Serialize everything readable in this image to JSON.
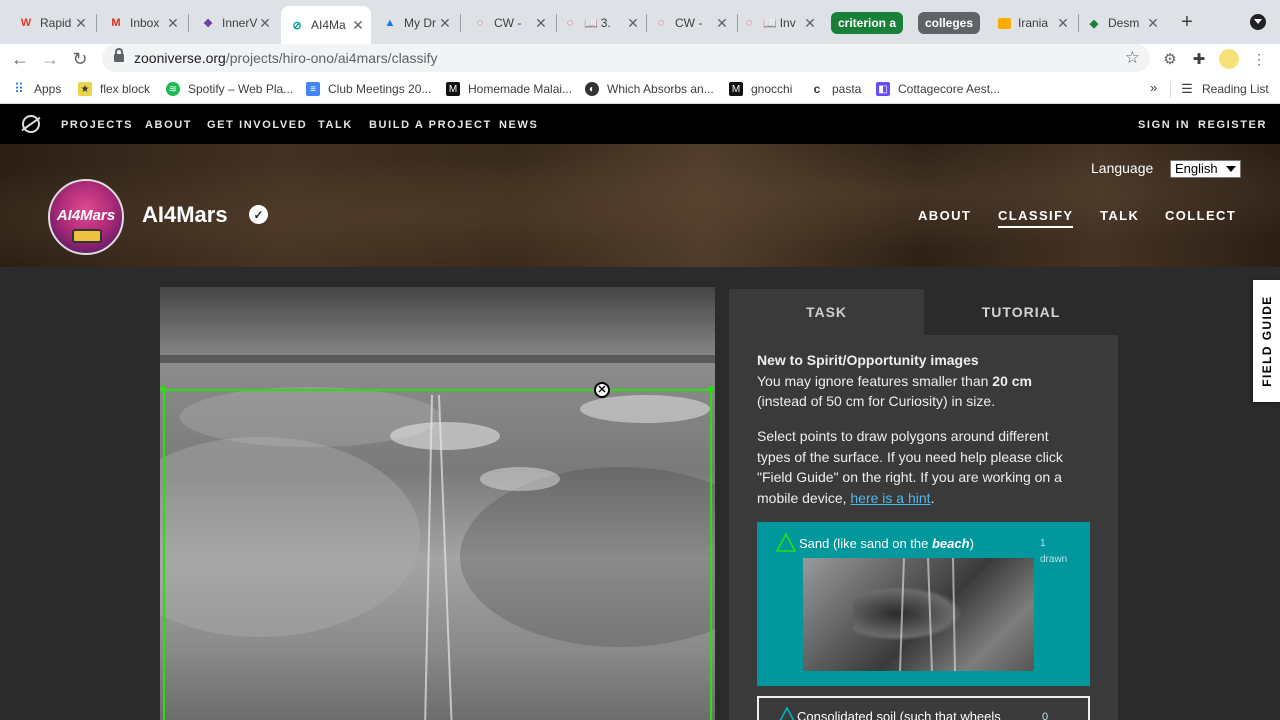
{
  "browser": {
    "tabs": [
      {
        "title": "Rapid",
        "favicon": "red-w-icon",
        "color": "#e53935"
      },
      {
        "title": "Inbox",
        "favicon": "gmail-icon",
        "color": "#d93025"
      },
      {
        "title": "InnerV",
        "favicon": "innerv-icon",
        "color": "#6a3ea1"
      },
      {
        "title": "AI4Ma",
        "favicon": "zooniverse-icon",
        "color": "#00979d"
      },
      {
        "title": "My Dr",
        "favicon": "drive-icon",
        "color": "#1a73e8"
      },
      {
        "title": "CW -",
        "favicon": "cw-icon",
        "color": "#d93025"
      },
      {
        "title": "3.",
        "favicon": "book-icon",
        "color": "#d93025"
      },
      {
        "title": "CW -",
        "favicon": "cw-icon",
        "color": "#d93025"
      },
      {
        "title": "Inv",
        "favicon": "book-icon",
        "color": "#d93025"
      }
    ],
    "groups": [
      {
        "label": "criterion a",
        "color": "#188038"
      },
      {
        "label": "colleges",
        "color": "#5f6368"
      }
    ],
    "group_tabs": [
      {
        "title": "Irania",
        "favicon": "slides-icon",
        "color": "#f9ab00"
      },
      {
        "title": "Desm",
        "favicon": "desmos-icon",
        "color": "#188038"
      }
    ],
    "url_host": "zooniverse.org",
    "url_path": "/projects/hiro-ono/ai4mars/classify"
  },
  "bookmarks": [
    {
      "label": "Apps",
      "icon": "apps-grid-icon"
    },
    {
      "label": "flex block",
      "icon": "bookmark-icon"
    },
    {
      "label": "Spotify – Web Pla...",
      "icon": "spotify-icon"
    },
    {
      "label": "Club Meetings 20...",
      "icon": "docs-icon"
    },
    {
      "label": "Homemade Malai...",
      "icon": "site-icon"
    },
    {
      "label": "Which Absorbs an...",
      "icon": "globe-icon"
    },
    {
      "label": "gnocchi",
      "icon": "site-icon"
    },
    {
      "label": "pasta",
      "icon": "c-icon"
    },
    {
      "label": "Cottagecore Aest...",
      "icon": "app-icon"
    },
    {
      "label": "Reading List",
      "icon": "reading-list-icon"
    }
  ],
  "zooniverse_nav": {
    "items": [
      "PROJECTS",
      "ABOUT",
      "GET INVOLVED",
      "TALK",
      "BUILD A PROJECT",
      "NEWS"
    ],
    "sign_in": "SIGN IN",
    "register": "REGISTER"
  },
  "project": {
    "avatar_text": "AI4Mars",
    "title": "AI4Mars",
    "language_label": "Language",
    "language_value": "English",
    "nav": [
      {
        "label": "ABOUT",
        "active": false
      },
      {
        "label": "CLASSIFY",
        "active": true
      },
      {
        "label": "TALK",
        "active": false
      },
      {
        "label": "COLLECT",
        "active": false
      }
    ]
  },
  "task": {
    "tab_task": "TASK",
    "tab_tutorial": "TUTORIAL",
    "intro_heading": "New to Spirit/Opportunity images",
    "intro_line1_prefix": "You may ignore features smaller than ",
    "intro_line1_bold": "20 cm",
    "intro_line2": "(instead of 50 cm for Curiosity) in size.",
    "instructions": "Select points to draw polygons around different types of the surface. If you need help please click \"Field Guide\" on the right. If you are working on a mobile device, ",
    "hint_link": "here is a hint",
    "instructions_end": ".",
    "answers": [
      {
        "label_prefix": "Sand (like sand on the ",
        "label_em": "beach",
        "label_suffix": ")",
        "count": "1",
        "count_label": "drawn",
        "color": "#00979d"
      },
      {
        "label": "Consolidated soil (such that wheels",
        "count": "0"
      }
    ]
  },
  "field_guide": "FIELD GUIDE",
  "colors": {
    "accent": "#00979d",
    "polygon": "#29e00d",
    "link": "#4fb8e8"
  }
}
